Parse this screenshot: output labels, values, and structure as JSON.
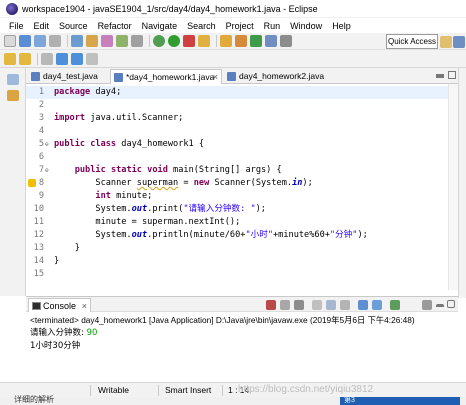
{
  "window": {
    "title": "workspace1904 - javaSE1904_1/src/day4/day4_homework1.java - Eclipse"
  },
  "menu": [
    "File",
    "Edit",
    "Source",
    "Refactor",
    "Navigate",
    "Search",
    "Project",
    "Run",
    "Window",
    "Help"
  ],
  "toolbar": {
    "quick_access_label": "Quick Access"
  },
  "tabs": [
    {
      "label": "day4_test.java",
      "active": false
    },
    {
      "label": "*day4_homework1.java",
      "active": true
    },
    {
      "label": "day4_homework2.java",
      "active": false
    }
  ],
  "editor": {
    "current_line": 1,
    "lines": [
      {
        "n": "1",
        "tokens": [
          {
            "t": "package",
            "c": "kw"
          },
          {
            "t": " day4;",
            "c": ""
          }
        ]
      },
      {
        "n": "2",
        "tokens": []
      },
      {
        "n": "3",
        "tokens": [
          {
            "t": "import",
            "c": "kw"
          },
          {
            "t": " java.util.Scanner;",
            "c": ""
          }
        ]
      },
      {
        "n": "4",
        "tokens": []
      },
      {
        "n": "5",
        "tokens": [
          {
            "t": "public",
            "c": "kw"
          },
          {
            "t": " ",
            "c": ""
          },
          {
            "t": "class",
            "c": "kw"
          },
          {
            "t": " day4_homework1 {",
            "c": ""
          }
        ]
      },
      {
        "n": "6",
        "tokens": []
      },
      {
        "n": "7",
        "tokens": [
          {
            "t": "    ",
            "c": ""
          },
          {
            "t": "public",
            "c": "kw"
          },
          {
            "t": " ",
            "c": ""
          },
          {
            "t": "static",
            "c": "kw"
          },
          {
            "t": " ",
            "c": ""
          },
          {
            "t": "void",
            "c": "kw"
          },
          {
            "t": " main(String[] args) {",
            "c": ""
          }
        ]
      },
      {
        "n": "8",
        "tokens": [
          {
            "t": "        Scanner ",
            "c": ""
          },
          {
            "t": "superman",
            "c": "warn"
          },
          {
            "t": " = ",
            "c": ""
          },
          {
            "t": "new",
            "c": "kw"
          },
          {
            "t": " Scanner(System.",
            "c": ""
          },
          {
            "t": "in",
            "c": "sfld"
          },
          {
            "t": ");",
            "c": ""
          }
        ]
      },
      {
        "n": "9",
        "tokens": [
          {
            "t": "        ",
            "c": ""
          },
          {
            "t": "int",
            "c": "kw"
          },
          {
            "t": " minute;",
            "c": ""
          }
        ]
      },
      {
        "n": "10",
        "tokens": [
          {
            "t": "        System.",
            "c": ""
          },
          {
            "t": "out",
            "c": "sfld"
          },
          {
            "t": ".print(",
            "c": ""
          },
          {
            "t": "\"请输入分钟数: \"",
            "c": "str"
          },
          {
            "t": ");",
            "c": ""
          }
        ]
      },
      {
        "n": "11",
        "tokens": [
          {
            "t": "        minute = superman.nextInt();",
            "c": ""
          }
        ]
      },
      {
        "n": "12",
        "tokens": [
          {
            "t": "        System.",
            "c": ""
          },
          {
            "t": "out",
            "c": "sfld"
          },
          {
            "t": ".println(minute/60+",
            "c": ""
          },
          {
            "t": "\"小时\"",
            "c": "str"
          },
          {
            "t": "+minute%60+",
            "c": ""
          },
          {
            "t": "\"分钟\"",
            "c": "str"
          },
          {
            "t": ");",
            "c": ""
          }
        ]
      },
      {
        "n": "13",
        "tokens": [
          {
            "t": "    }",
            "c": ""
          }
        ]
      },
      {
        "n": "14",
        "tokens": [
          {
            "t": "}",
            "c": ""
          }
        ]
      },
      {
        "n": "15",
        "tokens": []
      }
    ]
  },
  "console": {
    "tab_label": "Console",
    "terminated": "<terminated> day4_homework1 [Java Application] D:\\Java\\jre\\bin\\javaw.exe (2019年5月6日 下午4:26:48)",
    "prompt": "请输入分钟数: ",
    "input": "90",
    "output": "1小时30分钟"
  },
  "status": {
    "writable": "Writable",
    "insert_mode": "Smart Insert",
    "position": "1 : 14",
    "watermark": "https://blog.csdn.net/yiqiu3812"
  },
  "taskbar": {
    "left_text": "详细的解析",
    "right_text": "第3"
  },
  "colors": {
    "keyword": "#7f0055",
    "string": "#2a00ff",
    "static_field": "#0000c0",
    "console_input": "#00a000",
    "current_line": "#e8f2fe"
  }
}
